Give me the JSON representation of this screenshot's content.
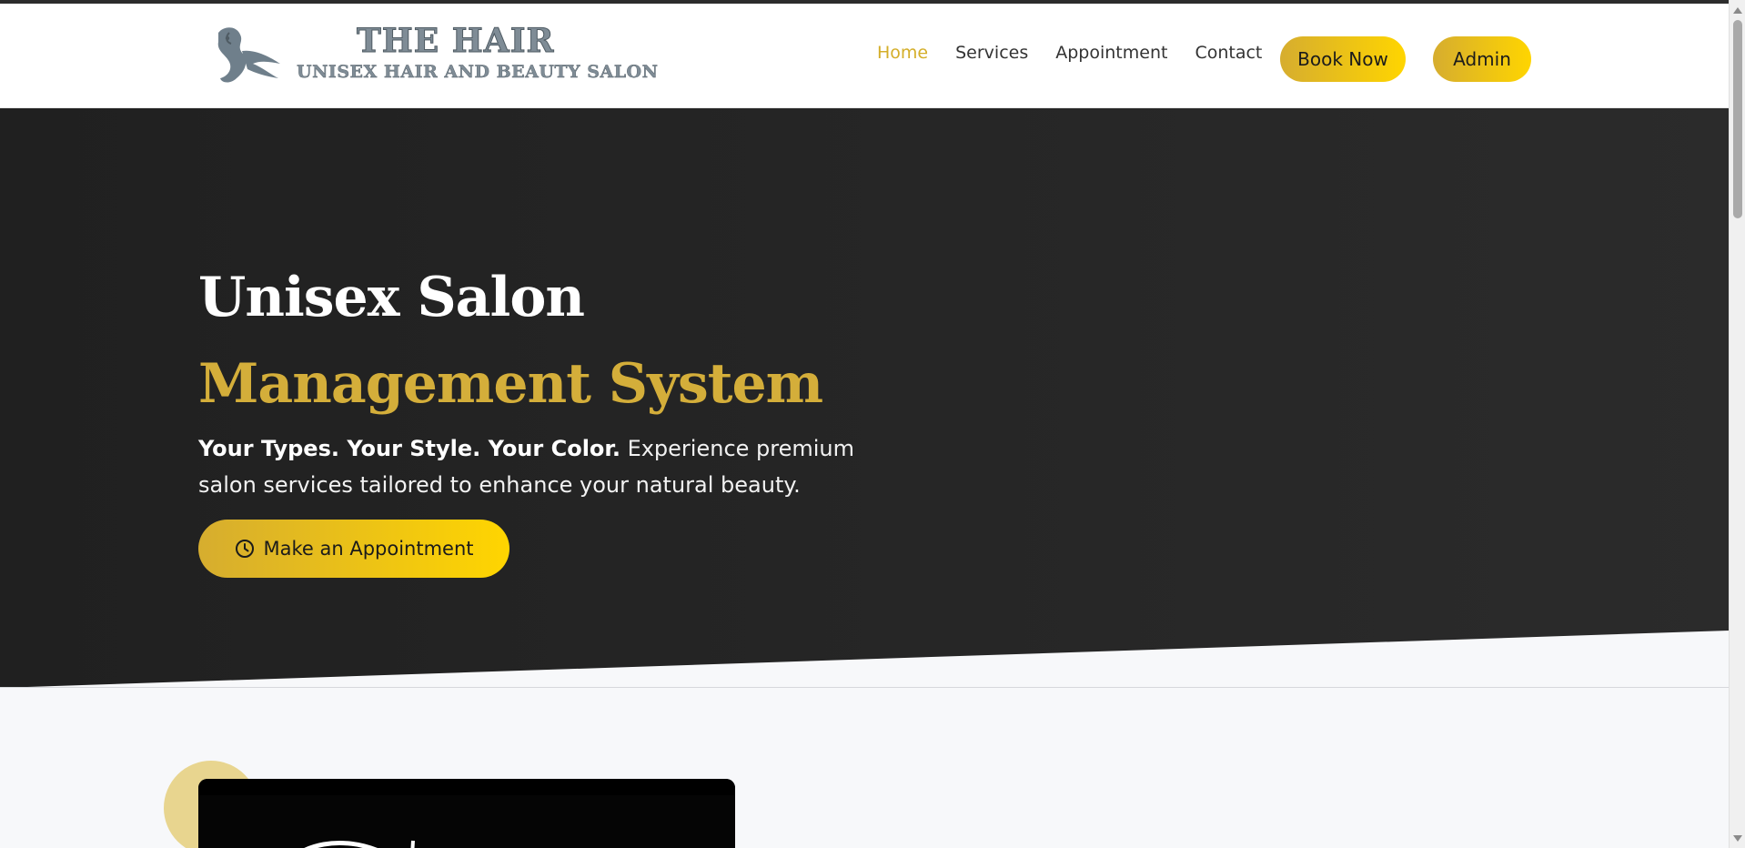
{
  "brand": {
    "title": "THE HAIR",
    "subtitle": "UNISEX HAIR AND BEAUTY SALON",
    "logo_icon": "woman-hair-silhouette-icon"
  },
  "nav": {
    "items": [
      {
        "label": "Home",
        "active": true
      },
      {
        "label": "Services",
        "active": false
      },
      {
        "label": "Appointment",
        "active": false
      },
      {
        "label": "Contact",
        "active": false
      }
    ],
    "book_label": "Book Now",
    "admin_label": "Admin"
  },
  "hero": {
    "title_line1": "Unisex Salon",
    "title_line2": "Management System",
    "tagline_bold": "Your Types. Your Style. Your Color.",
    "tagline_rest": " Experience premium salon services tailored to enhance your natural beauty.",
    "cta_label": "Make an Appointment",
    "cta_icon": "clock-icon"
  },
  "colors": {
    "accent": "#d4ae3a",
    "accent_gradient_start": "#d6ad2f",
    "accent_gradient_end": "#ffd500",
    "hero_dark": "#222222",
    "header_bg": "#ffffff",
    "section_bg": "#f7f8fa"
  }
}
